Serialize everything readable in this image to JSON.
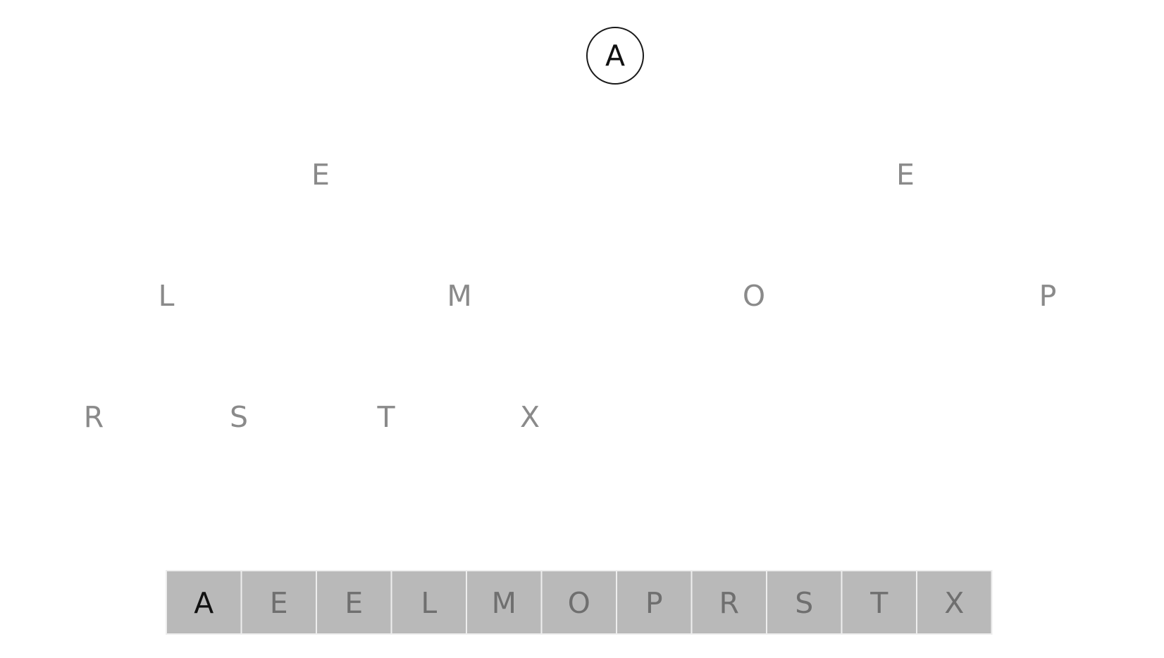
{
  "tree": {
    "nodes": [
      {
        "id": "n1",
        "label": "A",
        "state": "active",
        "circled": true
      },
      {
        "id": "n2",
        "label": "E",
        "state": "pending",
        "circled": false
      },
      {
        "id": "n3",
        "label": "E",
        "state": "pending",
        "circled": false
      },
      {
        "id": "n4",
        "label": "L",
        "state": "pending",
        "circled": false
      },
      {
        "id": "n5",
        "label": "M",
        "state": "pending",
        "circled": false
      },
      {
        "id": "n6",
        "label": "O",
        "state": "pending",
        "circled": false
      },
      {
        "id": "n7",
        "label": "P",
        "state": "pending",
        "circled": false
      },
      {
        "id": "n8",
        "label": "R",
        "state": "pending",
        "circled": false
      },
      {
        "id": "n9",
        "label": "S",
        "state": "pending",
        "circled": false
      },
      {
        "id": "n10",
        "label": "T",
        "state": "pending",
        "circled": false
      },
      {
        "id": "n11",
        "label": "X",
        "state": "pending",
        "circled": false
      }
    ]
  },
  "array": {
    "cells": [
      {
        "label": "A",
        "state": "active"
      },
      {
        "label": "E",
        "state": "pending"
      },
      {
        "label": "E",
        "state": "pending"
      },
      {
        "label": "L",
        "state": "pending"
      },
      {
        "label": "M",
        "state": "pending"
      },
      {
        "label": "O",
        "state": "pending"
      },
      {
        "label": "P",
        "state": "pending"
      },
      {
        "label": "R",
        "state": "pending"
      },
      {
        "label": "S",
        "state": "pending"
      },
      {
        "label": "T",
        "state": "pending"
      },
      {
        "label": "X",
        "state": "pending"
      }
    ]
  },
  "colors": {
    "active_text": "#111111",
    "pending_node_text": "#8a8a8a",
    "pending_cell_text": "#6f6f6f",
    "cell_fill": "#b9b9b9",
    "cell_divider": "#eeeeee",
    "background": "#ffffff"
  }
}
